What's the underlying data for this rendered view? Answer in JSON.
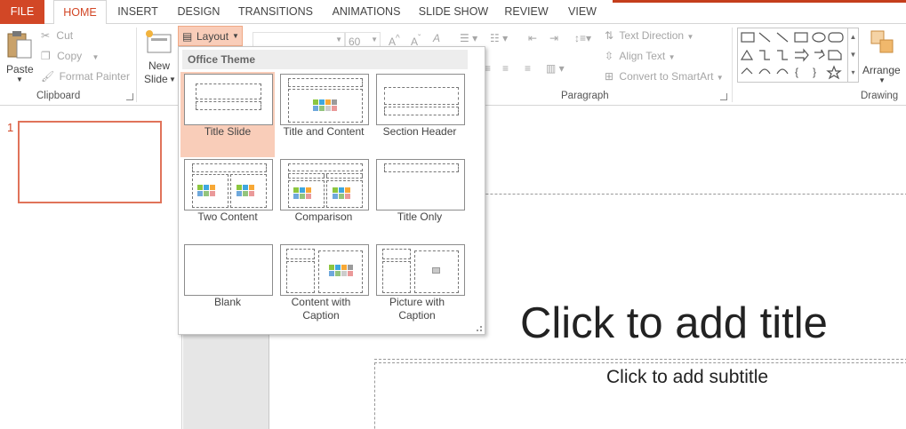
{
  "tabs": [
    "FILE",
    "HOME",
    "INSERT",
    "DESIGN",
    "TRANSITIONS",
    "ANIMATIONS",
    "SLIDE SHOW",
    "REVIEW",
    "VIEW"
  ],
  "clipboard": {
    "paste": "Paste",
    "cut": "Cut",
    "copy": "Copy",
    "format_painter": "Format Painter",
    "group_label": "Clipboard"
  },
  "slides": {
    "new_slide_line1": "New",
    "new_slide_line2": "Slide",
    "layout_button": "Layout"
  },
  "font": {
    "size": "60"
  },
  "paragraph": {
    "text_direction": "Text Direction",
    "align_text": "Align Text",
    "convert_smartart": "Convert to SmartArt",
    "group_label": "Paragraph"
  },
  "drawing": {
    "arrange": "Arrange",
    "group_label": "Drawing"
  },
  "thumbnail": {
    "number": "1"
  },
  "layout_menu": {
    "header": "Office Theme",
    "items": [
      {
        "label": "Title Slide"
      },
      {
        "label": "Title and Content"
      },
      {
        "label": "Section Header"
      },
      {
        "label": "Two Content"
      },
      {
        "label": "Comparison"
      },
      {
        "label": "Title Only"
      },
      {
        "label": "Blank"
      },
      {
        "label": "Content with Caption"
      },
      {
        "label": "Picture with Caption"
      }
    ],
    "selected": "Title Slide"
  },
  "slide_canvas": {
    "title_placeholder": "Click to add title",
    "subtitle_placeholder": "Click to add subtitle"
  },
  "colors": {
    "accent": "#d24726",
    "selection": "#f9cdb9"
  }
}
